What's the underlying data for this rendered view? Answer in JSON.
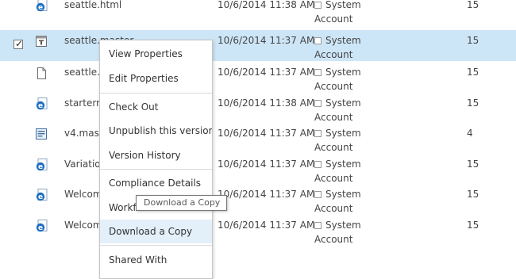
{
  "rows": [
    {
      "name": "seattle.html",
      "modified": "10/6/2014 11:38 AM",
      "user_line1": "System",
      "user_line2": "Account",
      "version": "15",
      "icon": "ie-html-file-icon"
    },
    {
      "name": "seattle.master",
      "modified": "10/6/2014 11:37 AM",
      "user_line1": "System",
      "user_line2": "Account",
      "version": "15",
      "icon": "master-page-file-icon",
      "selected": true
    },
    {
      "name": "seattle.p",
      "modified": "10/6/2014 11:37 AM",
      "user_line1": "System",
      "user_line2": "Account",
      "version": "15",
      "icon": "blank-file-icon"
    },
    {
      "name": "starterm",
      "modified": "10/6/2014 11:38 AM",
      "user_line1": "System",
      "user_line2": "Account",
      "version": "15",
      "icon": "ie-html-file-icon"
    },
    {
      "name": "v4.maste",
      "modified": "10/6/2014 11:37 AM",
      "user_line1": "System",
      "user_line2": "Account",
      "version": "4",
      "icon": "master-page-file-icon"
    },
    {
      "name": "Variation",
      "modified": "10/6/2014 11:37 AM",
      "user_line1": "System",
      "user_line2": "Account",
      "version": "15",
      "icon": "ie-html-file-icon"
    },
    {
      "name": "Welcome",
      "modified": "10/6/2014 11:37 AM",
      "user_line1": "System",
      "user_line2": "Account",
      "version": "15",
      "icon": "ie-html-file-icon"
    },
    {
      "name": "Welcome",
      "modified": "10/6/2014 11:37 AM",
      "user_line1": "System",
      "user_line2": "Account",
      "version": "15",
      "icon": "ie-html-file-icon"
    }
  ],
  "context_menu": {
    "items": [
      {
        "label": "View Properties"
      },
      {
        "label": "Edit Properties"
      },
      {
        "label": "Check Out"
      },
      {
        "label": "Unpublish this version"
      },
      {
        "label": "Version History"
      },
      {
        "label": "Compliance Details"
      },
      {
        "label": "Workflows"
      },
      {
        "label": "Download a Copy",
        "highlighted": true
      },
      {
        "label": "Shared With"
      }
    ]
  },
  "tooltip": {
    "text": "Download a Copy"
  },
  "colors": {
    "selected_row": "#cde6f7",
    "menu_hover": "#e3eff9",
    "ie_icon": "#1e6fc4"
  }
}
